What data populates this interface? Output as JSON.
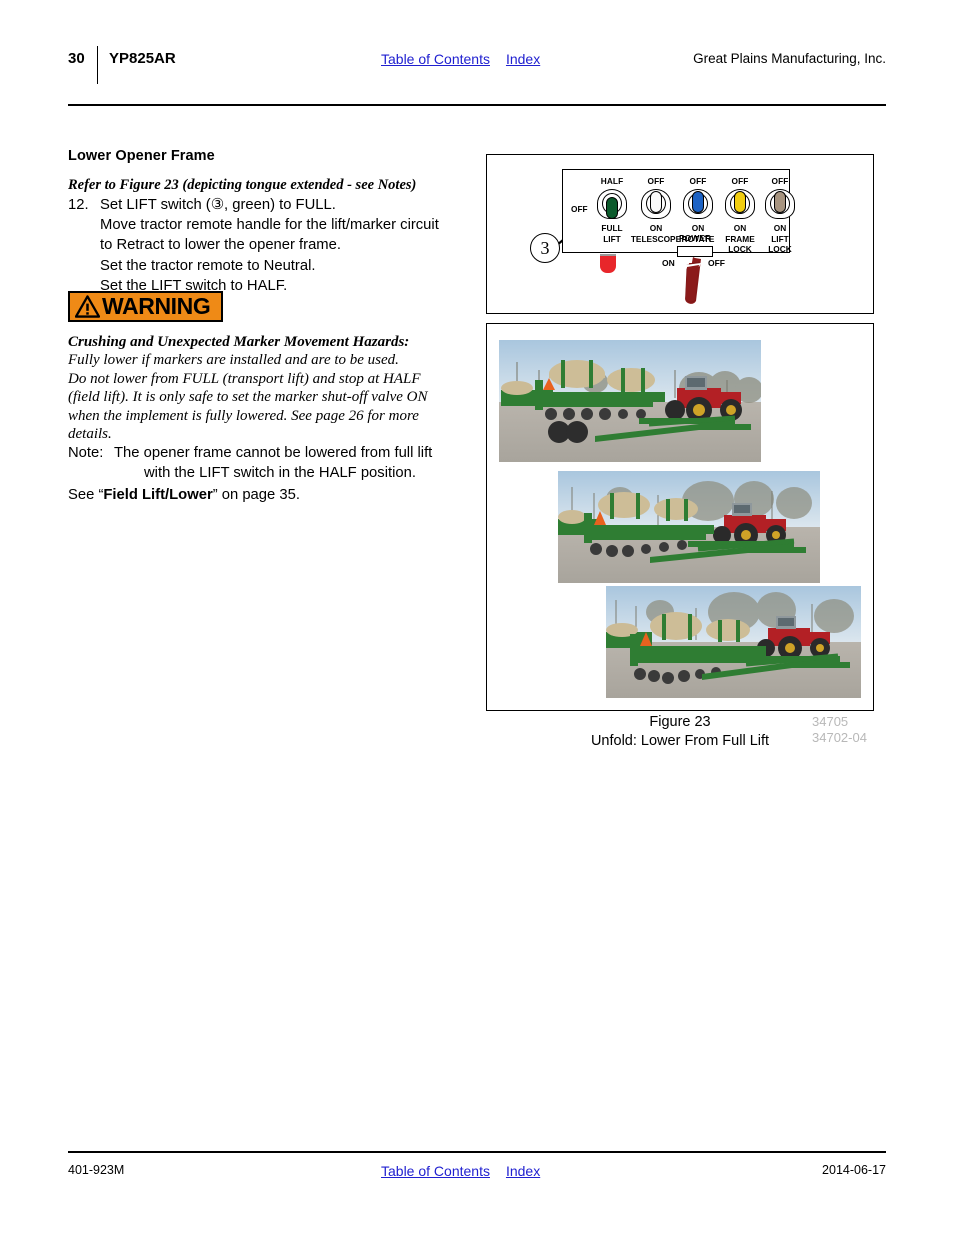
{
  "header": {
    "page_number": "30",
    "model": "YP825AR",
    "links": [
      "Table of Contents",
      "Index"
    ],
    "company": "Great Plains Manufacturing, Inc."
  },
  "section": {
    "title": "Lower Opener Frame",
    "refer_line": "Refer to Figure 23 (depicting tongue extended - see Notes)",
    "step": {
      "number": "12.",
      "lines": [
        "Set LIFT switch (③, green) to FULL.",
        "Move tractor remote handle for the lift/marker circuit",
        "to Retract to lower the opener frame.",
        "Set the tractor remote to Neutral.",
        "Set the LIFT switch to HALF."
      ]
    }
  },
  "warning": {
    "banner_label": "WARNING",
    "banner_bg": "#EF8A16",
    "heading": "Crushing and Unexpected Marker Movement Hazards:",
    "lines": [
      "Fully lower if markers are installed and are to be used.",
      "Do not lower from FULL (transport lift) and stop at HALF",
      "(field lift). It is only safe to set the marker shut-off valve ON",
      "when the implement is fully lowered. See page 26 for more",
      "details."
    ]
  },
  "note": {
    "label": "Note:",
    "line1": "The opener frame cannot be lowered from full lift",
    "line2": "with the LIFT switch in the HALF position."
  },
  "see_reference": {
    "prefix": "See “",
    "bold": "Field Lift/Lower",
    "suffix": "” on page 35."
  },
  "figure": {
    "caption_line1": "Figure 23",
    "caption_line2": "Unfold: Lower From Full Lift",
    "ref_numbers": [
      "34705",
      "34702-04"
    ],
    "callout_number": "3",
    "control_panel": {
      "left_label": "OFF",
      "power": {
        "label": "POWER",
        "on": "ON",
        "off": "OFF",
        "lever_color": "#8B1A1A"
      },
      "lamp_color": "#E8262B",
      "switches": [
        {
          "top": "HALF",
          "bottom": "FULL",
          "name": "LIFT",
          "color": "#0B5A2B",
          "position": "down"
        },
        {
          "top": "OFF",
          "bottom": "ON",
          "name": "TELESCOPE",
          "color": "#FAFAFA",
          "position": "up"
        },
        {
          "top": "OFF",
          "bottom": "ON",
          "name": "ROTATE",
          "color": "#1C62C4",
          "position": "up"
        },
        {
          "top": "OFF",
          "bottom": "ON",
          "name": "FRAME\nLOCK",
          "color": "#F2CE10",
          "position": "up"
        },
        {
          "top": "OFF",
          "bottom": "ON",
          "name": "LIFT\nLOCK",
          "color": "#A79480",
          "position": "up"
        }
      ]
    },
    "photos": [
      {
        "alt": "Planter at full lift, opener frame raised, green implement with tan seed tanks and red tractor"
      },
      {
        "alt": "Planter partially lowered, opener frame mid travel"
      },
      {
        "alt": "Planter fully lowered to field position, openers on ground"
      }
    ]
  },
  "footer": {
    "document_code": "401-923M",
    "links": [
      "Table of Contents",
      "Index"
    ],
    "date": "2014-06-17"
  }
}
